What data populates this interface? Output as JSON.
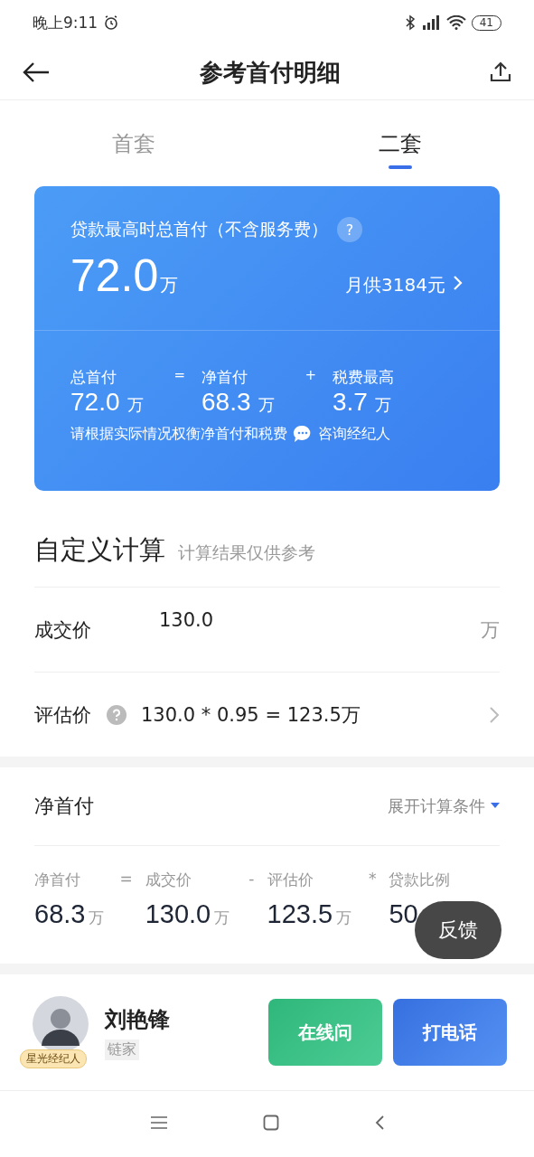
{
  "status_bar": {
    "time": "晚上9:11",
    "battery": "41"
  },
  "header": {
    "title": "参考首付明细"
  },
  "tabs": [
    {
      "label": "首套",
      "selected": false
    },
    {
      "label": "二套",
      "selected": true
    }
  ],
  "summary": {
    "title": "贷款最高时总首付（不含服务费）",
    "help": "?",
    "amount": "72.0",
    "amount_unit": "万",
    "monthly": "月供3184元",
    "parts": [
      {
        "label": "总首付",
        "value": "72.0",
        "unit": "万",
        "op": "="
      },
      {
        "label": "净首付",
        "value": "68.3",
        "unit": "万",
        "op": "+"
      },
      {
        "label": "税费最高",
        "value": "3.7",
        "unit": "万"
      }
    ],
    "note": "请根据实际情况权衡净首付和税费",
    "consult": "咨询经纪人"
  },
  "custom": {
    "title": "自定义计算",
    "subtitle": "计算结果仅供参考",
    "rows": [
      {
        "kind": "input",
        "label": "成交价",
        "value": "130.0",
        "unit": "万"
      },
      {
        "kind": "link",
        "label": "评估价",
        "value": "130.0 * 0.95 = 123.5万"
      }
    ]
  },
  "net": {
    "title": "净首付",
    "expand": "展开计算条件",
    "terms": [
      {
        "label": "净首付",
        "value": "68.3",
        "unit": "万",
        "op": "="
      },
      {
        "label": "成交价",
        "value": "130.0",
        "unit": "万",
        "op": "-"
      },
      {
        "label": "评估价",
        "value": "123.5",
        "unit": "万",
        "op": "*"
      },
      {
        "label": "贷款比例",
        "value": "50"
      }
    ]
  },
  "feedback": "反馈",
  "agent": {
    "badge": "星光经纪人",
    "name": "刘艳锋",
    "company": "链家",
    "chat": "在线问",
    "call": "打电话"
  }
}
